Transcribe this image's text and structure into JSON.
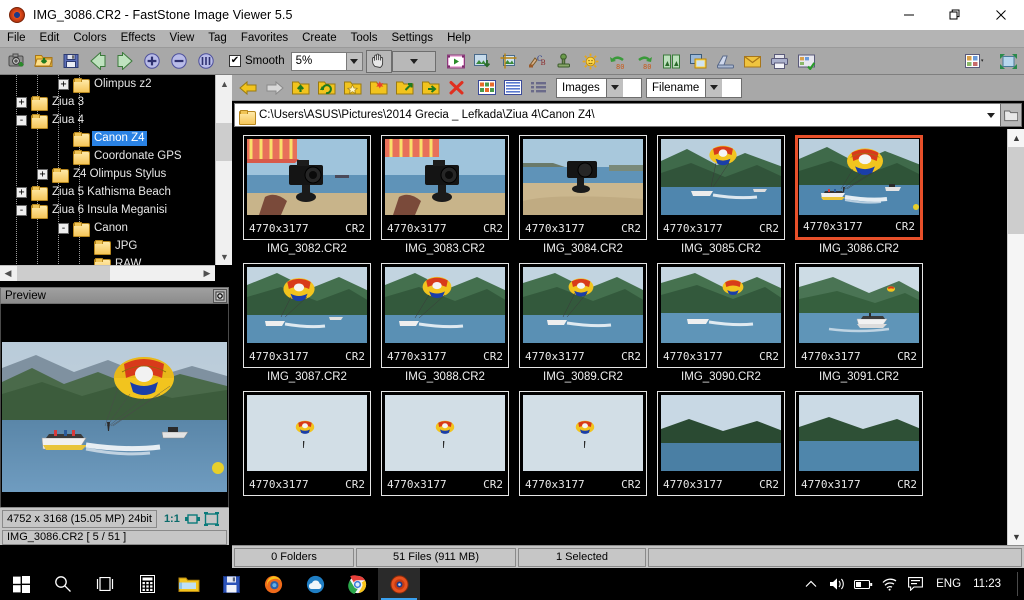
{
  "window": {
    "title": "IMG_3086.CR2  -  FastStone Image Viewer 5.5",
    "icon": "faststone-app-icon",
    "minimize_label": "–",
    "maximize_label": "❐",
    "close_label": "✕"
  },
  "menubar": {
    "items": [
      {
        "label": "File"
      },
      {
        "label": "Edit"
      },
      {
        "label": "Colors"
      },
      {
        "label": "Effects"
      },
      {
        "label": "View"
      },
      {
        "label": "Tag"
      },
      {
        "label": "Favorites"
      },
      {
        "label": "Create"
      },
      {
        "label": "Tools"
      },
      {
        "label": "Settings"
      },
      {
        "label": "Help"
      }
    ]
  },
  "toolbar": {
    "smooth_label": "Smooth",
    "smooth_checked": true,
    "smooth_check_glyph": "✔",
    "zoom_value": "5%",
    "buttons": [
      {
        "icon": "camera-capture-icon"
      },
      {
        "icon": "open-folder-icon"
      },
      {
        "icon": "save-icon"
      },
      {
        "icon": "previous-image-icon"
      },
      {
        "icon": "next-image-icon"
      },
      {
        "icon": "zoom-in-icon"
      },
      {
        "icon": "zoom-out-icon"
      },
      {
        "icon": "actual-size-icon"
      }
    ],
    "right_buttons": [
      {
        "icon": "slideshow-icon"
      },
      {
        "icon": "compare-images-icon"
      },
      {
        "icon": "crop-icon"
      },
      {
        "icon": "adjust-colors-icon"
      },
      {
        "icon": "clone-stamp-icon"
      },
      {
        "icon": "lighting-icon"
      },
      {
        "icon": "undo-icon"
      },
      {
        "icon": "redo-icon"
      },
      {
        "icon": "flip-icon"
      },
      {
        "icon": "resize-icon"
      },
      {
        "icon": "scan-icon"
      },
      {
        "icon": "email-icon"
      },
      {
        "icon": "print-icon"
      },
      {
        "icon": "contact-sheet-icon"
      }
    ],
    "layout_icon": "window-layout-icon",
    "fullscreen_icon": "fullscreen-icon",
    "hand_icon": "hand-tool-icon"
  },
  "folder_tree": {
    "nodes": [
      {
        "label": "Olimpus z2",
        "depth": 3,
        "expander": "+"
      },
      {
        "label": "Ziua 3",
        "depth": 2,
        "expander": "+"
      },
      {
        "label": "Ziua 4",
        "depth": 2,
        "expander": "-"
      },
      {
        "label": "Canon Z4",
        "depth": 3,
        "expander": "",
        "selected": true
      },
      {
        "label": "Coordonate GPS",
        "depth": 3,
        "expander": ""
      },
      {
        "label": "Z4 Olimpus Stylus",
        "depth": 3,
        "expander": "+"
      },
      {
        "label": "Ziua 5 Kathisma Beach",
        "depth": 2,
        "expander": "+"
      },
      {
        "label": "Ziua 6 Insula Meganisi",
        "depth": 2,
        "expander": "-"
      },
      {
        "label": "Canon",
        "depth": 3,
        "expander": "-"
      },
      {
        "label": "JPG",
        "depth": 4,
        "expander": ""
      },
      {
        "label": "RAW",
        "depth": 4,
        "expander": ""
      }
    ]
  },
  "preview": {
    "title": "Preview",
    "toggle_icon": "preview-toggle-icon",
    "image_alt": "parasailing-over-sea-preview"
  },
  "image_status": {
    "dimensions": "4752 x 3168 (15.05 MP)  24bit",
    "bit_depth_included": true,
    "zoom_ratio": "1:1",
    "fit_window_icon": "fit-to-window-icon",
    "fit_screen_icon": "fit-to-screen-icon",
    "filename_index": "IMG_3086.CR2 [ 5 / 51 ]"
  },
  "browser_toolbar": {
    "buttons": [
      {
        "icon": "back-arrow-icon"
      },
      {
        "icon": "forward-arrow-icon"
      },
      {
        "icon": "up-folder-icon"
      },
      {
        "icon": "refresh-folder-icon"
      },
      {
        "icon": "favorite-folder-icon"
      },
      {
        "icon": "new-folder-icon"
      },
      {
        "icon": "copy-to-folder-icon"
      },
      {
        "icon": "move-to-folder-icon"
      },
      {
        "icon": "delete-icon"
      },
      {
        "icon": "thumbnail-view-icon"
      },
      {
        "icon": "list-view-icon"
      },
      {
        "icon": "detail-view-icon"
      }
    ],
    "filter_value": "Images",
    "sort_value": "Filename"
  },
  "path_bar": {
    "value": "C:\\Users\\ASUS\\Pictures\\2014 Grecia _ Lefkada\\Ziua 4\\Canon Z4\\",
    "folder_icon": "folder-icon",
    "dropdown_icon": "chevron-down-icon",
    "browse_icon": "browse-folder-icon"
  },
  "thumbnails": {
    "resolution_label": "4770x3177",
    "format_label": "CR2",
    "items": [
      {
        "name": "IMG_3082.CR2",
        "art": "camera-on-beach",
        "selected": false
      },
      {
        "name": "IMG_3083.CR2",
        "art": "camera-on-beach",
        "selected": false
      },
      {
        "name": "IMG_3084.CR2",
        "art": "camera-on-sand",
        "selected": false
      },
      {
        "name": "IMG_3085.CR2",
        "art": "parasail-distant",
        "selected": false
      },
      {
        "name": "IMG_3086.CR2",
        "art": "parasail-close",
        "selected": true
      },
      {
        "name": "IMG_3087.CR2",
        "art": "parasail-hill",
        "selected": false
      },
      {
        "name": "IMG_3088.CR2",
        "art": "parasail-hill",
        "selected": false
      },
      {
        "name": "IMG_3089.CR2",
        "art": "parasail-hill",
        "selected": false
      },
      {
        "name": "IMG_3090.CR2",
        "art": "parasail-hill",
        "selected": false
      },
      {
        "name": "IMG_3091.CR2",
        "art": "boat-sea",
        "selected": false
      },
      {
        "name": "",
        "art": "parasail-sky",
        "selected": false
      },
      {
        "name": "",
        "art": "parasail-sky",
        "selected": false
      },
      {
        "name": "",
        "art": "parasail-sky",
        "selected": false
      },
      {
        "name": "",
        "art": "island-sea",
        "selected": false
      },
      {
        "name": "",
        "art": "island-sea",
        "selected": false
      }
    ]
  },
  "bottom_status": {
    "folders": "0 Folders",
    "files": "51 Files (911 MB)",
    "selected": "1 Selected",
    "extra": ""
  },
  "taskbar": {
    "items": [
      {
        "icon": "windows-start-icon"
      },
      {
        "icon": "search-icon"
      },
      {
        "icon": "task-view-icon"
      },
      {
        "icon": "calculator-icon"
      },
      {
        "icon": "file-explorer-icon"
      },
      {
        "icon": "save-disk-icon"
      },
      {
        "icon": "firefox-icon"
      },
      {
        "icon": "weather-icon"
      },
      {
        "icon": "chrome-icon"
      },
      {
        "icon": "faststone-icon",
        "active": true
      }
    ],
    "tray": {
      "show_hidden_icon": "chevron-up-icon",
      "volume_icon": "speaker-icon",
      "battery_icon": "battery-icon",
      "wifi_icon": "wifi-icon",
      "action_center_icon": "message-icon",
      "language": "ENG",
      "clock": "11:23"
    }
  },
  "colors": {
    "accent": "#e8502a",
    "selection": "#2a82e4",
    "chrome": "#a8a8a8",
    "panel_bg": "#000000"
  }
}
